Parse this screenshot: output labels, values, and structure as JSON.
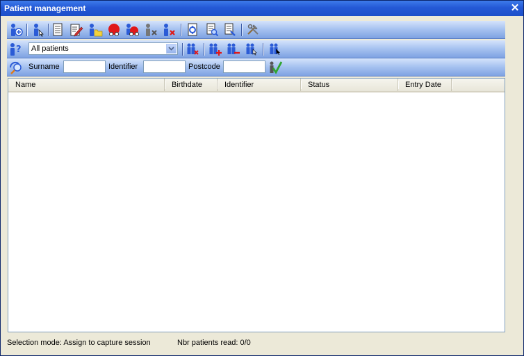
{
  "window": {
    "title": "Patient management",
    "close_symbol": "✕"
  },
  "toolbar_main": {
    "buttons": [
      {
        "name": "add-patient-icon"
      },
      {
        "name": "select-patient-icon"
      },
      {
        "name": "document-icon"
      },
      {
        "name": "edit-patient-icon"
      },
      {
        "name": "patient-folder-icon"
      },
      {
        "name": "record-red-icon"
      },
      {
        "name": "record-blue-icon"
      },
      {
        "name": "patient-remove-gray-icon"
      },
      {
        "name": "patient-delete-icon"
      },
      {
        "name": "export-icon"
      },
      {
        "name": "report-search-icon"
      },
      {
        "name": "report-list-icon"
      },
      {
        "name": "tools-icon"
      }
    ]
  },
  "filter_bar": {
    "selected_filter": "All patients",
    "buttons": [
      {
        "name": "group-patient-query-icon"
      },
      {
        "name": "remove-group-icon"
      },
      {
        "name": "add-to-group-icon"
      },
      {
        "name": "remove-from-group-icon"
      },
      {
        "name": "group-select-icon"
      },
      {
        "name": "group-select-all-icon"
      }
    ]
  },
  "search_bar": {
    "surname_label": "Surname",
    "surname_value": "",
    "identifier_label": "Identifier",
    "identifier_value": "",
    "postcode_label": "Postcode",
    "postcode_value": ""
  },
  "table": {
    "columns": [
      "Name",
      "Birthdate",
      "Identifier",
      "Status",
      "Entry Date"
    ],
    "rows": []
  },
  "status": {
    "selection_mode": "Selection mode: Assign to capture session",
    "patients_read": "Nbr patients read: 0/0"
  },
  "colors": {
    "titlebar": "#2459D6",
    "toolbar_gradient_top": "#D5E3FB",
    "toolbar_gradient_bottom": "#7EA2E2",
    "icon_blue": "#2B5BD6",
    "icon_red": "#E01818",
    "confirm_green": "#2FA52F"
  }
}
